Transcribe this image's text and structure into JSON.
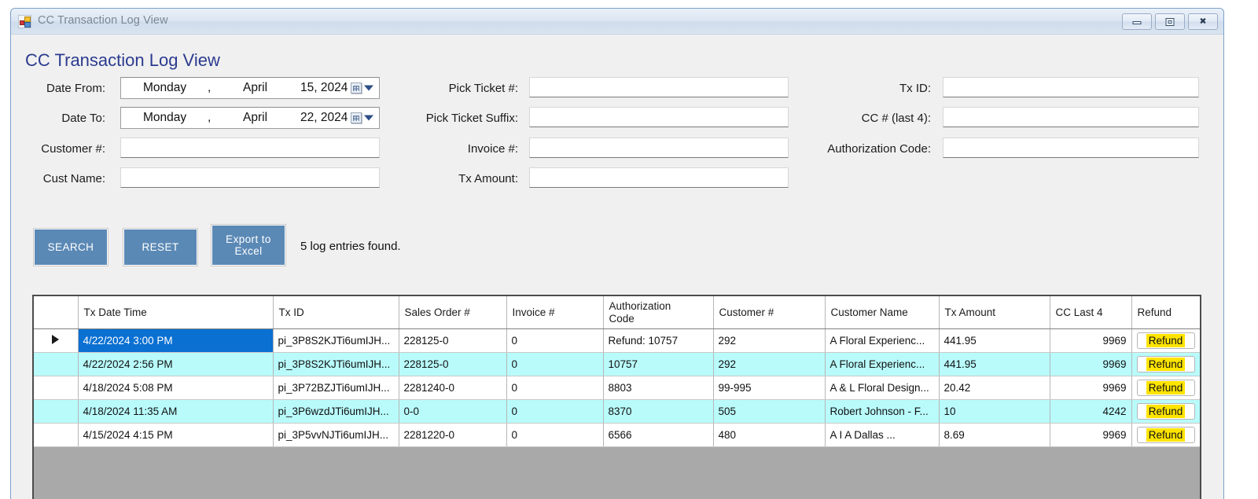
{
  "window": {
    "title": "CC Transaction Log View",
    "app_icon": "winforms-icon",
    "controls": {
      "minimize": "minimize",
      "maximize": "restore",
      "close": "close"
    }
  },
  "page_title": "CC Transaction Log View",
  "form": {
    "date_from": {
      "label": "Date From:",
      "day": "Monday",
      "comma": ",",
      "month": "April",
      "daynum_year": "15, 2024"
    },
    "date_to": {
      "label": "Date To:",
      "day": "Monday",
      "comma": ",",
      "month": "April",
      "daynum_year": "22, 2024"
    },
    "customer_no": {
      "label": "Customer #:",
      "value": "",
      "placeholder": ""
    },
    "cust_name": {
      "label": "Cust Name:",
      "value": "",
      "placeholder": ""
    },
    "pick_ticket_no": {
      "label": "Pick Ticket #:",
      "value": "",
      "placeholder": ""
    },
    "pick_ticket_suffix": {
      "label": "Pick Ticket Suffix:",
      "value": "",
      "placeholder": ""
    },
    "invoice_no": {
      "label": "Invoice #:",
      "value": "",
      "placeholder": ""
    },
    "tx_amount": {
      "label": "Tx Amount:",
      "value": "",
      "placeholder": ""
    },
    "tx_id": {
      "label": "Tx ID:",
      "value": "",
      "placeholder": ""
    },
    "cc_last4": {
      "label": "CC # (last 4):",
      "value": "",
      "placeholder": ""
    },
    "authorization_code": {
      "label": "Authorization Code:",
      "value": "",
      "placeholder": ""
    }
  },
  "actions": {
    "search": "SEARCH",
    "reset": "RESET",
    "export_line1": "Export to",
    "export_line2": "Excel",
    "status": "5 log entries found."
  },
  "grid": {
    "columns": [
      "Tx Date Time",
      "Tx ID",
      "Sales Order #",
      "Invoice #",
      "Authorization Code",
      "Customer #",
      "Customer Name",
      "Tx Amount",
      "CC Last 4",
      "Refund"
    ],
    "auth_code_header_line1": "Authorization",
    "auth_code_header_line2": "Code",
    "refund_button_label": "Refund",
    "rows": [
      {
        "selected": true,
        "tx_date_time": "4/22/2024 3:00 PM",
        "tx_id": "pi_3P8S2KJTi6umIJH...",
        "sales_order": "228125-0",
        "invoice": "0",
        "auth_code": "Refund: 10757",
        "customer_no": "292",
        "customer_name": "A Floral Experienc...",
        "tx_amount": "441.95",
        "cc_last4": "9969",
        "refund": "Refund"
      },
      {
        "selected": false,
        "tx_date_time": "4/22/2024 2:56 PM",
        "tx_id": "pi_3P8S2KJTi6umIJH...",
        "sales_order": "228125-0",
        "invoice": "0",
        "auth_code": "10757",
        "customer_no": "292",
        "customer_name": "A Floral Experienc...",
        "tx_amount": "441.95",
        "cc_last4": "9969",
        "refund": "Refund"
      },
      {
        "selected": false,
        "tx_date_time": "4/18/2024 5:08 PM",
        "tx_id": "pi_3P72BZJTi6umIJH...",
        "sales_order": "2281240-0",
        "invoice": "0",
        "auth_code": "8803",
        "customer_no": "99-995",
        "customer_name": "A & L Floral Design...",
        "tx_amount": "20.42",
        "cc_last4": "9969",
        "refund": "Refund"
      },
      {
        "selected": false,
        "tx_date_time": "4/18/2024 11:35 AM",
        "tx_id": "pi_3P6wzdJTi6umIJH...",
        "sales_order": "0-0",
        "invoice": "0",
        "auth_code": "8370",
        "customer_no": "505",
        "customer_name": "Robert Johnson - F...",
        "tx_amount": "10",
        "cc_last4": "4242",
        "refund": "Refund"
      },
      {
        "selected": false,
        "tx_date_time": "4/15/2024 4:15 PM",
        "tx_id": "pi_3P5vvNJTi6umIJH...",
        "sales_order": "2281220-0",
        "invoice": "0",
        "auth_code": "6566",
        "customer_no": "480",
        "customer_name": "A I A Dallas          ...",
        "tx_amount": "8.69",
        "cc_last4": "9969",
        "refund": "Refund"
      }
    ]
  },
  "colors": {
    "title_accent": "#2b3b8f",
    "button_blue": "#5b89b5",
    "selected_row": "#0a70d2",
    "alt_row": "#b9fbfb",
    "refund_highlight": "#ffe400",
    "grid_empty": "#a9a9a9"
  }
}
